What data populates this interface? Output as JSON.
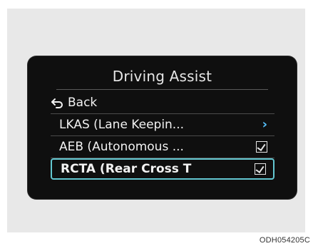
{
  "menu": {
    "title": "Driving Assist",
    "back_label": "Back",
    "items": [
      {
        "label": "LKAS (Lane Keepin...",
        "right_control": "chevron-right",
        "selected": false
      },
      {
        "label": "AEB (Autonomous ...",
        "right_control": "checkbox",
        "checked": true,
        "selected": false
      },
      {
        "label": "RCTA (Rear Cross T",
        "right_control": "checkbox",
        "checked": true,
        "selected": true
      }
    ]
  },
  "figure_code": "ODH054205C",
  "colors": {
    "screen_bg": "#0f0f0f",
    "text": "#f2f2f2",
    "selection_border": "#63c7d1",
    "chevron": "#56c2ff"
  },
  "icons": {
    "back": "back-arrow-icon",
    "chevron": "chevron-right-icon",
    "checkbox": "checkbox-checked-icon"
  }
}
